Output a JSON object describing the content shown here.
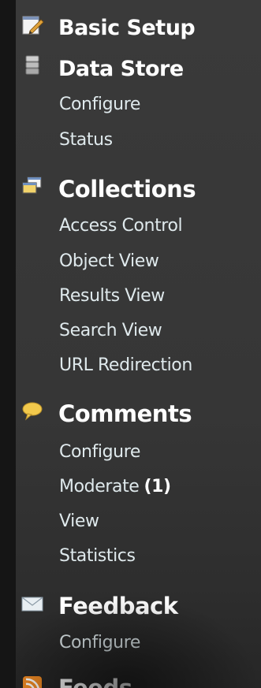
{
  "sidebar": {
    "sections": [
      {
        "title": "Basic Setup",
        "icon": "pencil-icon",
        "items": []
      },
      {
        "title": "Data Store",
        "icon": "database-icon",
        "items": [
          {
            "label": "Configure"
          },
          {
            "label": "Status"
          }
        ]
      },
      {
        "title": "Collections",
        "icon": "windows-icon",
        "items": [
          {
            "label": "Access Control"
          },
          {
            "label": "Object View"
          },
          {
            "label": "Results View"
          },
          {
            "label": "Search View"
          },
          {
            "label": "URL Redirection"
          }
        ]
      },
      {
        "title": "Comments",
        "icon": "speech-bubble-icon",
        "items": [
          {
            "label": "Configure"
          },
          {
            "label": "Moderate",
            "count": "(1)"
          },
          {
            "label": "View"
          },
          {
            "label": "Statistics"
          }
        ]
      },
      {
        "title": "Feedback",
        "icon": "envelope-icon",
        "items": [
          {
            "label": "Configure"
          }
        ]
      },
      {
        "title": "Feeds",
        "icon": "rss-icon",
        "items": []
      }
    ]
  },
  "colors": {
    "background": "#151515",
    "panel": "#373737",
    "heading": "#ffffff",
    "link": "#dfe9ec",
    "bubble": "#f2c94c",
    "rss": "#f08a24"
  }
}
